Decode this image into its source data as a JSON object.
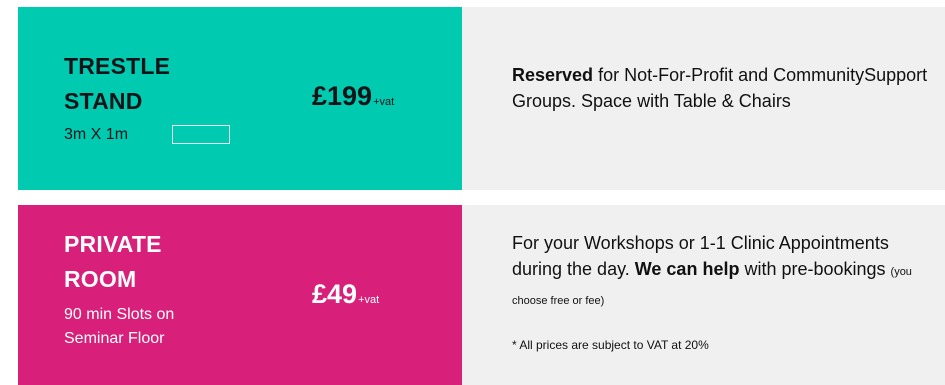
{
  "trestle": {
    "title_line1": "TRESTLE",
    "title_line2": "STAND",
    "dimensions": "3m X 1m",
    "price": "£199",
    "vat": "+vat",
    "desc_bold": "Reserved",
    "desc_rest": " for Not-For-Profit and CommunitySupport Groups. Space with Table & Chairs"
  },
  "private": {
    "title_line1": "PRIVATE",
    "title_line2": "ROOM",
    "sub_line1": "90 min Slots on",
    "sub_line2": "Seminar Floor",
    "price": "£49",
    "vat": "+vat",
    "desc_part1": "For your Workshops or 1-1 Clinic Appointments during the day. ",
    "desc_bold1": "We can help",
    "desc_part2": " with pre-bookings ",
    "desc_small": "(you choose free or fee)",
    "footnote": "* All prices are subject to VAT at 20%"
  },
  "colors": {
    "teal": "#00cbb1",
    "pink": "#d81f7a",
    "grey": "#f0f0f0"
  }
}
